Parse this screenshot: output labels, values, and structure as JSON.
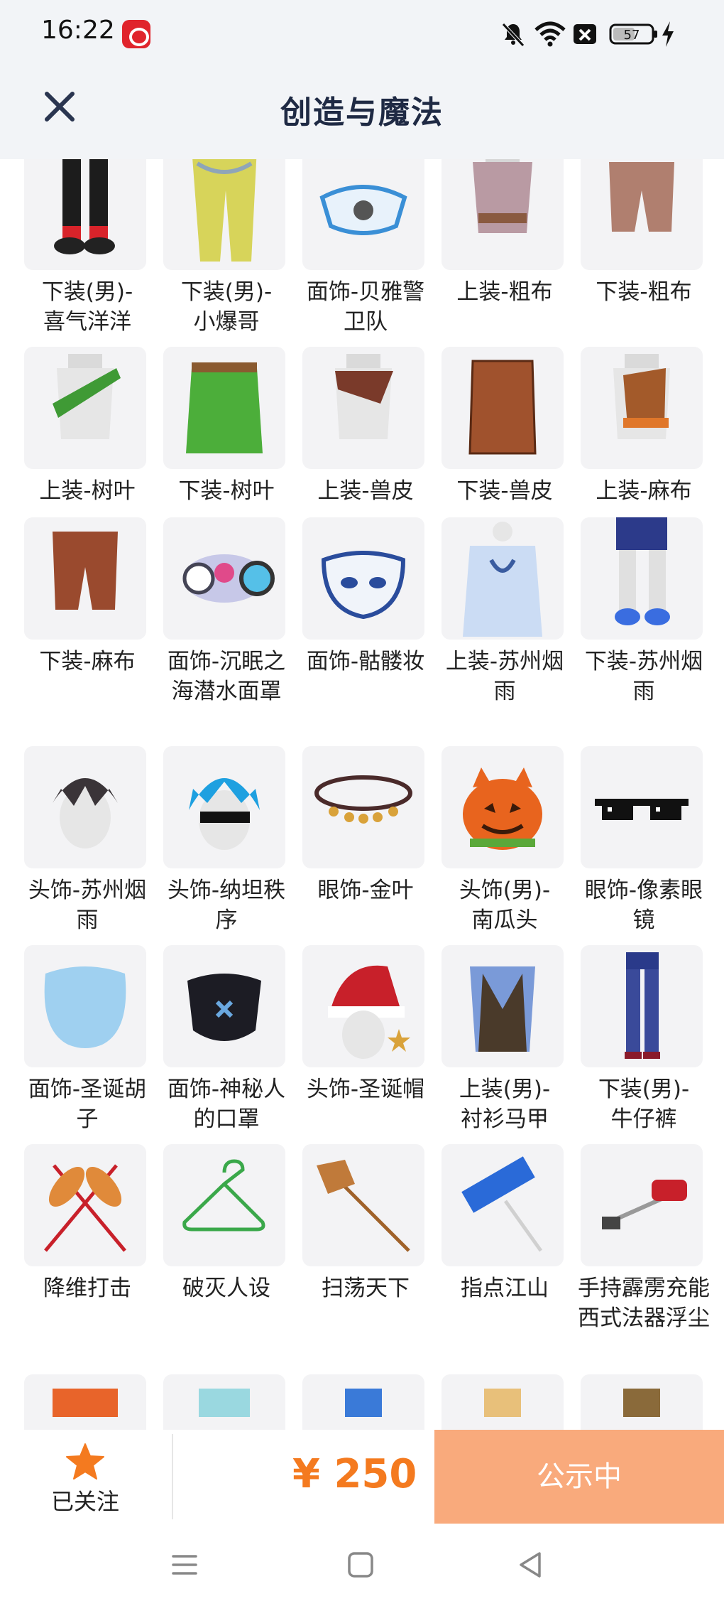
{
  "status_bar": {
    "time": "16:22",
    "battery": "57"
  },
  "header": {
    "title": "创造与魔法"
  },
  "items": [
    {
      "label": "下装(男)-喜气洋洋",
      "icon": "pants-black-red"
    },
    {
      "label": "下装(男)-小爆哥",
      "icon": "pants-yellow"
    },
    {
      "label": "面饰-贝雅警卫队",
      "icon": "face-mask-blue"
    },
    {
      "label": "上装-粗布",
      "icon": "top-linen"
    },
    {
      "label": "下装-粗布",
      "icon": "shorts-linen"
    },
    {
      "label": "上装-树叶",
      "icon": "top-leaf"
    },
    {
      "label": "下装-树叶",
      "icon": "skirt-leaf"
    },
    {
      "label": "上装-兽皮",
      "icon": "top-hide"
    },
    {
      "label": "下装-兽皮",
      "icon": "skirt-hide"
    },
    {
      "label": "上装-麻布",
      "icon": "top-hemp"
    },
    {
      "label": "下装-麻布",
      "icon": "shorts-hemp"
    },
    {
      "label": "面饰-沉眠之海潜水面罩",
      "icon": "dive-mask"
    },
    {
      "label": "面饰-骷髅妆",
      "icon": "skull-mask"
    },
    {
      "label": "上装-苏州烟雨",
      "icon": "top-suzhou"
    },
    {
      "label": "下装-苏州烟雨",
      "icon": "pants-suzhou"
    },
    {
      "label": "头饰-苏州烟雨",
      "icon": "hair-dark"
    },
    {
      "label": "头饰-纳坦秩序",
      "icon": "hair-blue"
    },
    {
      "label": "眼饰-金叶",
      "icon": "headband-gold"
    },
    {
      "label": "头饰(男)-南瓜头",
      "icon": "pumpkin-head"
    },
    {
      "label": "眼饰-像素眼镜",
      "icon": "pixel-glasses"
    },
    {
      "label": "面饰-圣诞胡子",
      "icon": "beard-blue"
    },
    {
      "label": "面饰-神秘人的口罩",
      "icon": "face-mask-black"
    },
    {
      "label": "头饰-圣诞帽",
      "icon": "santa-hat"
    },
    {
      "label": "上装(男)-衬衫马甲",
      "icon": "vest-shirt"
    },
    {
      "label": "下装(男)-牛仔裤",
      "icon": "jeans"
    },
    {
      "label": "降维打击",
      "icon": "crossed-dusters"
    },
    {
      "label": "破灭人设",
      "icon": "hanger"
    },
    {
      "label": "扫荡天下",
      "icon": "broom"
    },
    {
      "label": "指点江山",
      "icon": "sign-pole"
    },
    {
      "label": "手持霹雳充能西式法器浮尘",
      "icon": "vacuum"
    },
    {
      "label": "",
      "icon": "partial-orange"
    },
    {
      "label": "",
      "icon": "partial-teal"
    },
    {
      "label": "",
      "icon": "partial-blue"
    },
    {
      "label": "",
      "icon": "partial-gold"
    },
    {
      "label": "",
      "icon": "partial-brown"
    }
  ],
  "bottom_bar": {
    "follow_label": "已关注",
    "price": "¥ 250",
    "status_button": "公示中"
  },
  "colors": {
    "accent": "#f47a1f",
    "button": "#f9aa7c",
    "header_bg": "#f2f4f7"
  }
}
